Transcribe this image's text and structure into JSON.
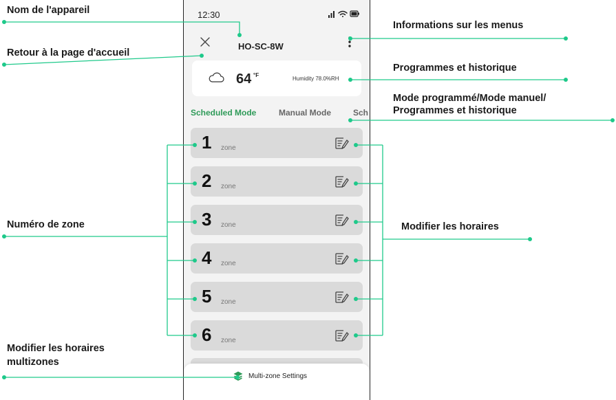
{
  "phone": {
    "status_bar": {
      "time": "12:30"
    },
    "header": {
      "device_name": "HO-SC-8W"
    },
    "weather": {
      "icon": "cloud-icon",
      "temperature": "64",
      "unit": "°F",
      "humidity": "Humidity  78.0%RH"
    },
    "tabs": [
      {
        "label": "Scheduled Mode",
        "active": true
      },
      {
        "label": "Manual Mode",
        "active": false
      },
      {
        "label": "Sch",
        "active": false
      }
    ],
    "zones": [
      {
        "number": "1",
        "label": "zone"
      },
      {
        "number": "2",
        "label": "zone"
      },
      {
        "number": "3",
        "label": "zone"
      },
      {
        "number": "4",
        "label": "zone"
      },
      {
        "number": "5",
        "label": "zone"
      },
      {
        "number": "6",
        "label": "zone"
      }
    ],
    "bottom_sheet": {
      "label": "Multi-zone Settings",
      "icon": "layers-icon"
    }
  },
  "annotations": {
    "device_name": "Nom de l'appareil",
    "home": "Retour à la page d'accueil",
    "menu_info": "Informations sur les menus",
    "programs_history": "Programmes et historique",
    "mode_line1": "Mode programmé/Mode manuel/",
    "mode_line2": "Programmes et historique",
    "zone_number": "Numéro de zone",
    "edit_schedules": "Modifier les horaires",
    "multizone_line1": "Modifier les horaires",
    "multizone_line2": "multizones"
  },
  "colors": {
    "accent": "#2e9a58",
    "annotation_line": "#1ec98a",
    "zone_bg": "#dadada",
    "phone_bg": "#f3f3f3"
  }
}
